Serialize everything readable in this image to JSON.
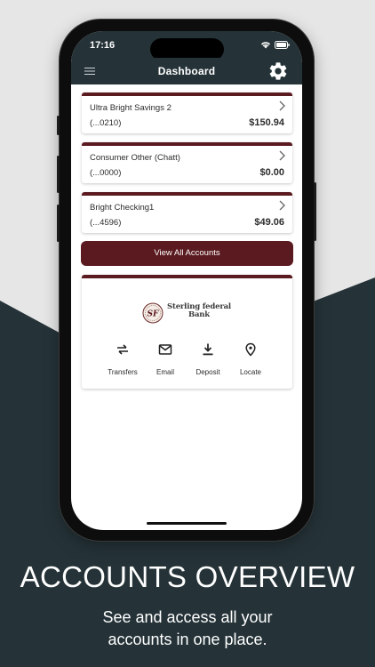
{
  "status_bar": {
    "time": "17:16"
  },
  "nav": {
    "title": "Dashboard"
  },
  "accounts": [
    {
      "name": "Ultra Bright Savings 2",
      "number": "(...0210)",
      "balance": "$150.94"
    },
    {
      "name": "Consumer Other (Chatt)",
      "number": "(...0000)",
      "balance": "$0.00"
    },
    {
      "name": "Bright Checking1",
      "number": "(...4596)",
      "balance": "$49.06"
    }
  ],
  "view_all_label": "View All Accounts",
  "bank": {
    "logo_initials": "SF",
    "logo_line1": "Sterling federal",
    "logo_line2": "Bank"
  },
  "quick_actions": [
    {
      "label": "Transfers",
      "icon": "transfer-icon"
    },
    {
      "label": "Email",
      "icon": "mail-icon"
    },
    {
      "label": "Deposit",
      "icon": "download-icon"
    },
    {
      "label": "Locate",
      "icon": "location-pin-icon"
    }
  ],
  "promo": {
    "headline": "ACCOUNTS OVERVIEW",
    "subline_1": "See and access all your",
    "subline_2": "accounts in one place."
  },
  "colors": {
    "accent": "#5a1a1f",
    "header_bg": "#253338",
    "promo_bg": "#253338",
    "light_bg": "#e6e6e6"
  }
}
